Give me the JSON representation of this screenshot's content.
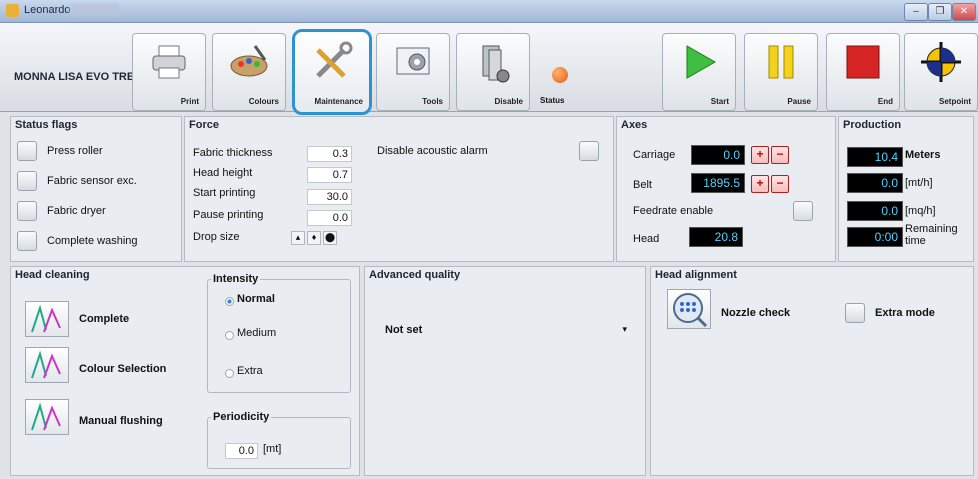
{
  "window": {
    "title": "Leonardo"
  },
  "toolbar": {
    "machine_name": "MONNA LISA EVO TRE",
    "buttons": {
      "print": "Print",
      "colours": "Colours",
      "maintenance": "Maintenance",
      "tools": "Tools",
      "disable": "Disable",
      "status": "Status",
      "start": "Start",
      "pause": "Pause",
      "end": "End",
      "setpoint": "Setpoint"
    }
  },
  "status_flags": {
    "title": "Status flags",
    "items": [
      "Press roller",
      "Fabric sensor exc.",
      "Fabric dryer",
      "Complete washing"
    ]
  },
  "force": {
    "title": "Force",
    "fabric_thickness": {
      "label": "Fabric thickness",
      "value": "0.3"
    },
    "head_height": {
      "label": "Head height",
      "value": "0.7"
    },
    "start_printing": {
      "label": "Start printing",
      "value": "30.0"
    },
    "pause_printing": {
      "label": "Pause printing",
      "value": "0.0"
    },
    "drop_size": {
      "label": "Drop size"
    },
    "acoustic_alarm": "Disable acoustic alarm"
  },
  "axes": {
    "title": "Axes",
    "carriage": {
      "label": "Carriage",
      "value": "0.0"
    },
    "belt": {
      "label": "Belt",
      "value": "1895.5"
    },
    "feedrate": "Feedrate enable",
    "head": {
      "label": "Head",
      "value": "20.8"
    }
  },
  "production": {
    "title": "Production",
    "rows": [
      {
        "value": "10.4",
        "unit": "Meters"
      },
      {
        "value": "0.0",
        "unit": "[mt/h]"
      },
      {
        "value": "0.0",
        "unit": "[mq/h]"
      },
      {
        "value": "0:00",
        "unit": "Remaining time"
      }
    ]
  },
  "head_cleaning": {
    "title": "Head cleaning",
    "complete": "Complete",
    "colour_selection": "Colour Selection",
    "manual_flushing": "Manual flushing",
    "intensity": {
      "title": "Intensity",
      "options": [
        "Normal",
        "Medium",
        "Extra"
      ],
      "selected": "Normal"
    },
    "periodicity": {
      "title": "Periodicity",
      "value": "0.0",
      "unit": "[mt]"
    }
  },
  "advanced_quality": {
    "title": "Advanced quality",
    "value": "Not set"
  },
  "head_alignment": {
    "title": "Head alignment",
    "nozzle_check": "Nozzle check",
    "extra_mode": "Extra mode"
  },
  "colors": {
    "accent": "#2e92d0",
    "display_bg": "#000000",
    "display_fg": "#4fd3ff"
  }
}
